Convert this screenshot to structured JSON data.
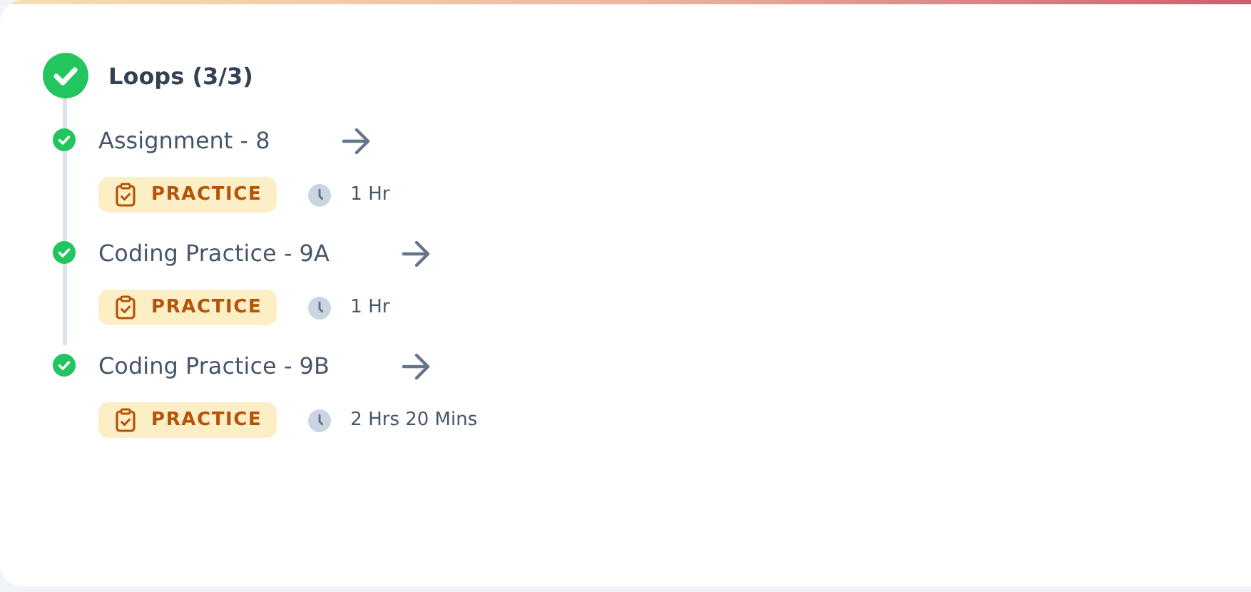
{
  "module": {
    "title": "Loops (3/3)",
    "completed": true
  },
  "items": [
    {
      "title": "Assignment - 8",
      "completed": true,
      "tag": "PRACTICE",
      "duration": "1 Hr"
    },
    {
      "title": "Coding Practice - 9A",
      "completed": true,
      "tag": "PRACTICE",
      "duration": "1 Hr"
    },
    {
      "title": "Coding Practice - 9B",
      "completed": true,
      "tag": "PRACTICE",
      "duration": "2 Hrs 20 Mins"
    }
  ]
}
